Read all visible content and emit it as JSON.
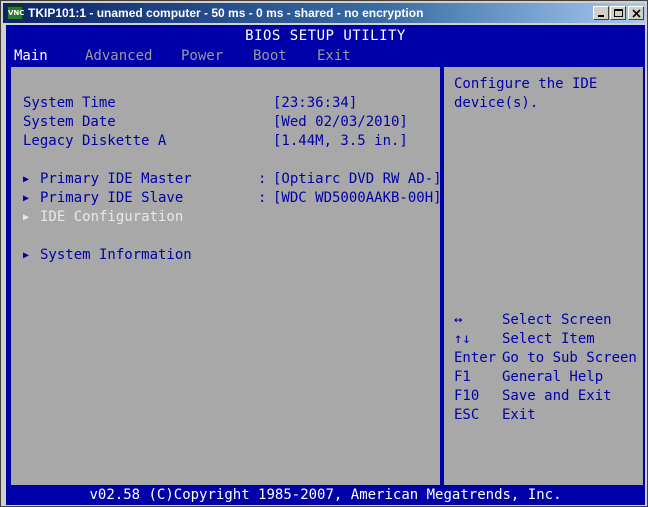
{
  "window": {
    "title": "TKIP101:1 - unamed computer - 50 ms - 0 ms - shared - no encryption",
    "icon_name": "vnc-app-icon",
    "icon_text": "VNC"
  },
  "bios": {
    "utility_title": "BIOS SETUP UTILITY",
    "tabs": [
      {
        "label": "Main",
        "active": true
      },
      {
        "label": "Advanced",
        "active": false
      },
      {
        "label": "Power",
        "active": false
      },
      {
        "label": "Boot",
        "active": false
      },
      {
        "label": "Exit",
        "active": false
      }
    ],
    "settings": [
      {
        "label": "System Time",
        "value": "[23:36:34]"
      },
      {
        "label": "System Date",
        "value": "[Wed 02/03/2010]"
      },
      {
        "label": "Legacy Diskette A",
        "value": "[1.44M, 3.5 in.]"
      }
    ],
    "submenus": [
      {
        "arrow": "▶",
        "label": "Primary IDE Master",
        "colon": ":",
        "value": "[Optiarc DVD RW AD-]",
        "highlighted": false
      },
      {
        "arrow": "▶",
        "label": "Primary IDE Slave",
        "colon": ":",
        "value": "[WDC WD5000AAKB-00H]",
        "highlighted": false
      },
      {
        "arrow": "▶",
        "label": "IDE Configuration",
        "highlighted": true
      },
      {
        "arrow": "▶",
        "label": "System Information",
        "highlighted": false
      }
    ],
    "help": {
      "text": "Configure the IDE device(s).",
      "keys": [
        {
          "key": "↔",
          "desc": "Select Screen"
        },
        {
          "key": "↑↓",
          "desc": "Select Item"
        },
        {
          "key": "Enter",
          "desc": "Go to Sub Screen"
        },
        {
          "key": "F1",
          "desc": "General Help"
        },
        {
          "key": "F10",
          "desc": "Save and Exit"
        },
        {
          "key": "ESC",
          "desc": "Exit"
        }
      ]
    },
    "footer": "v02.58 (C)Copyright 1985-2007, American Megatrends, Inc.",
    "colors": {
      "background": "#0000a8",
      "panel": "#a8a8a8",
      "text": "#0000a8",
      "highlight": "#ffffff",
      "inactive_tab": "#9a9a9a"
    }
  }
}
